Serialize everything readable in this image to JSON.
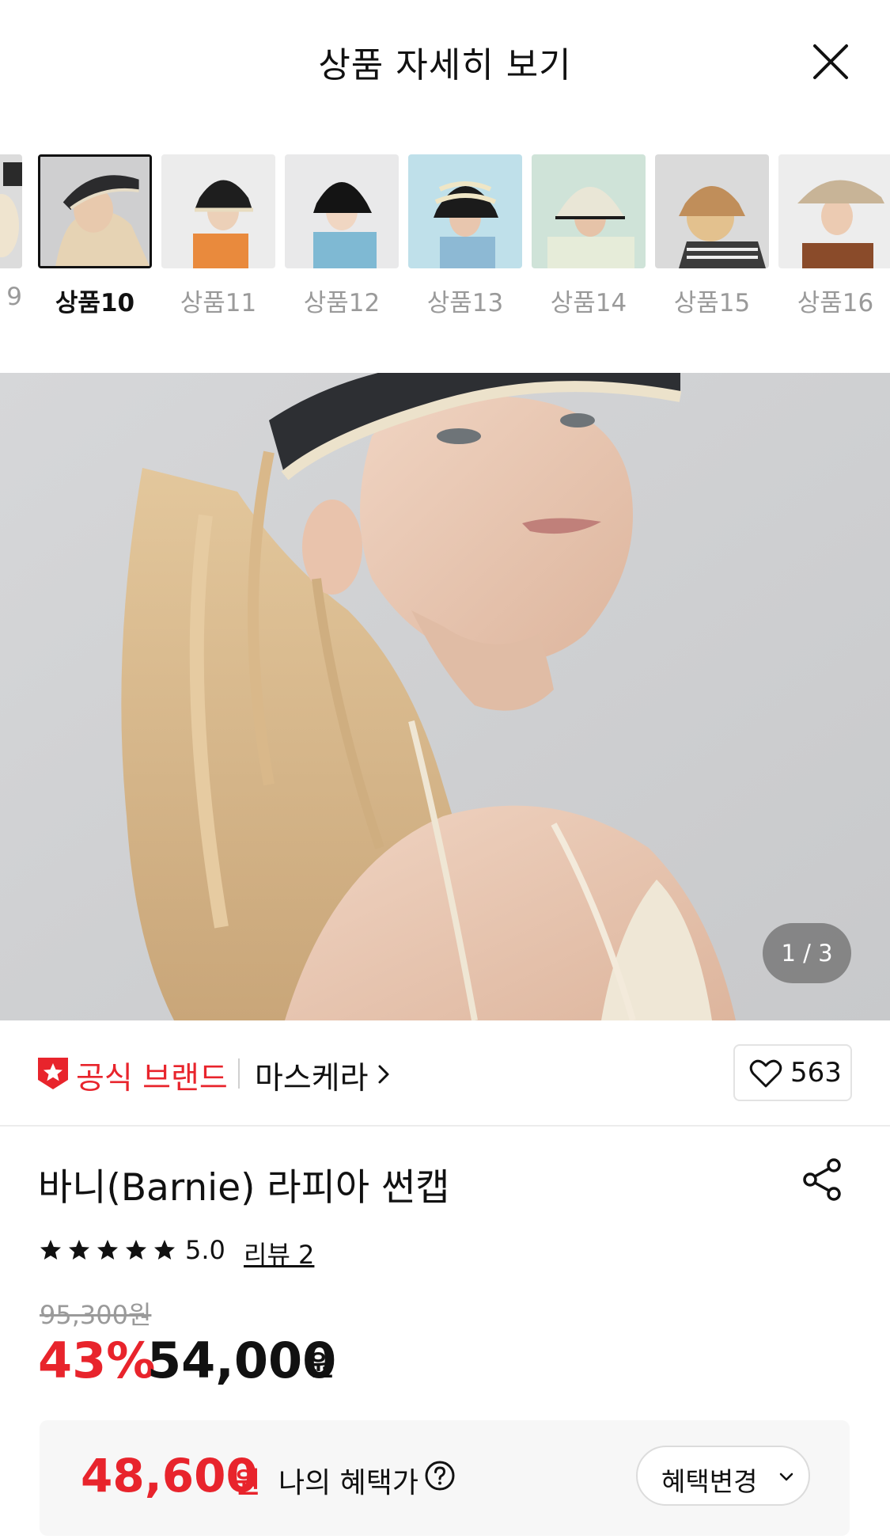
{
  "header": {
    "title": "상품 자세히 보기",
    "close_icon": "close-icon"
  },
  "thumbnails": [
    {
      "label": "9",
      "active": false
    },
    {
      "label": "상품10",
      "active": true
    },
    {
      "label": "상품11",
      "active": false
    },
    {
      "label": "상품12",
      "active": false
    },
    {
      "label": "상품13",
      "active": false
    },
    {
      "label": "상품14",
      "active": false
    },
    {
      "label": "상품15",
      "active": false
    },
    {
      "label": "상품16",
      "active": false
    }
  ],
  "gallery": {
    "counter": "1 / 3"
  },
  "brand": {
    "official_label": "공식 브랜드",
    "name": "마스케라",
    "badge_icon": "star-badge-icon",
    "likes": "563"
  },
  "product": {
    "name": "바니(Barnie) 라피아 썬캡",
    "rating": "5.0",
    "stars": 5,
    "review_link": "리뷰 2",
    "original_price": "95,300원",
    "discount": "43%",
    "sale_price": "54,000",
    "won": "원"
  },
  "benefit": {
    "price": "48,600",
    "won": "원",
    "label": "나의 혜택가",
    "change_label": "혜택변경"
  },
  "colors": {
    "accent_red": "#e8242c",
    "text": "#111111",
    "muted": "#9a9a9a"
  }
}
